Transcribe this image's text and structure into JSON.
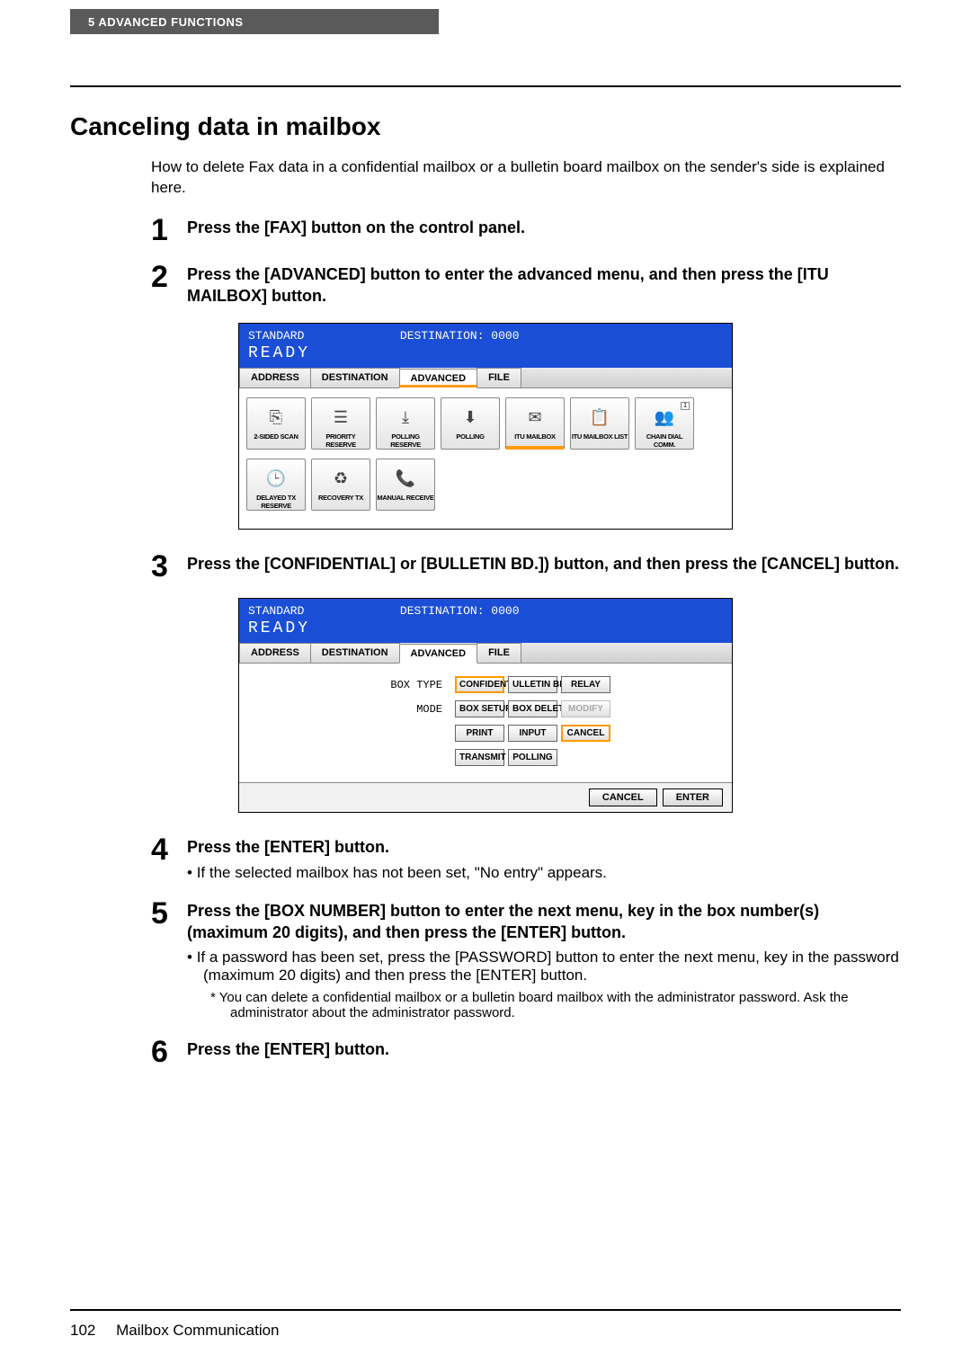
{
  "header_tab": "5   ADVANCED FUNCTIONS",
  "section_title": "Canceling data in mailbox",
  "intro": "How to delete Fax data in a confidential mailbox or a bulletin board mailbox on the sender's side is explained here.",
  "steps": {
    "s1": {
      "num": "1",
      "heading": "Press the [FAX] button on the control panel."
    },
    "s2": {
      "num": "2",
      "heading": "Press the [ADVANCED] button to enter the advanced menu, and then press the [ITU MAILBOX] button."
    },
    "s3": {
      "num": "3",
      "heading": "Press the [CONFIDENTIAL] or [BULLETIN BD.]) button, and then press the [CANCEL] button."
    },
    "s4": {
      "num": "4",
      "heading": "Press the [ENTER] button.",
      "sub": "If the selected mailbox has not been set, \"No entry\" appears."
    },
    "s5": {
      "num": "5",
      "heading": "Press the [BOX NUMBER] button to enter the next menu, key in the box number(s) (maximum 20 digits), and then press the [ENTER] button.",
      "sub": "If a password has been set, press the [PASSWORD] button to enter the next menu, key in the password (maximum 20 digits) and then press the [ENTER] button.",
      "sub2": "You can delete a confidential mailbox or a bulletin board mailbox with the administrator password. Ask the administrator about the administrator password."
    },
    "s6": {
      "num": "6",
      "heading": "Press the [ENTER] button."
    }
  },
  "fax1": {
    "standard": "STANDARD",
    "destination": "DESTINATION: 0000",
    "ready": "READY",
    "tabs": {
      "address": "ADDRESS",
      "destination_tab": "DESTINATION",
      "advanced": "ADVANCED",
      "file": "FILE"
    },
    "icons_row1": {
      "two_sided": "2-SIDED SCAN",
      "priority": "PRIORITY RESERVE",
      "polling_reserve": "POLLING RESERVE",
      "polling": "POLLING",
      "itu_mailbox": "ITU MAILBOX",
      "itu_list": "ITU MAILBOX LIST",
      "chain": "CHAIN DIAL COMM."
    },
    "icons_row2": {
      "delayed": "DELAYED TX RESERVE",
      "recovery": "RECOVERY TX",
      "manual": "MANUAL RECEIVE"
    }
  },
  "fax2": {
    "standard": "STANDARD",
    "destination": "DESTINATION: 0000",
    "ready": "READY",
    "tabs": {
      "address": "ADDRESS",
      "destination_tab": "DESTINATION",
      "advanced": "ADVANCED",
      "file": "FILE"
    },
    "labels": {
      "box_type": "BOX TYPE",
      "mode": "MODE"
    },
    "box_type_btns": {
      "confidential": "CONFIDENTIAL",
      "bulletin": "ULLETIN BD.",
      "relay": "RELAY"
    },
    "mode_btns_r1": {
      "box_setup": "BOX SETUP",
      "box_delete": "BOX DELETE",
      "modify": "MODIFY"
    },
    "mode_btns_r2": {
      "print": "PRINT",
      "input": "INPUT",
      "cancel": "CANCEL"
    },
    "mode_btns_r3": {
      "transmit": "TRANSMIT",
      "polling": "POLLING"
    },
    "footer": {
      "cancel": "CANCEL",
      "enter": "ENTER"
    }
  },
  "footer": {
    "page": "102",
    "title": "Mailbox Communication"
  }
}
